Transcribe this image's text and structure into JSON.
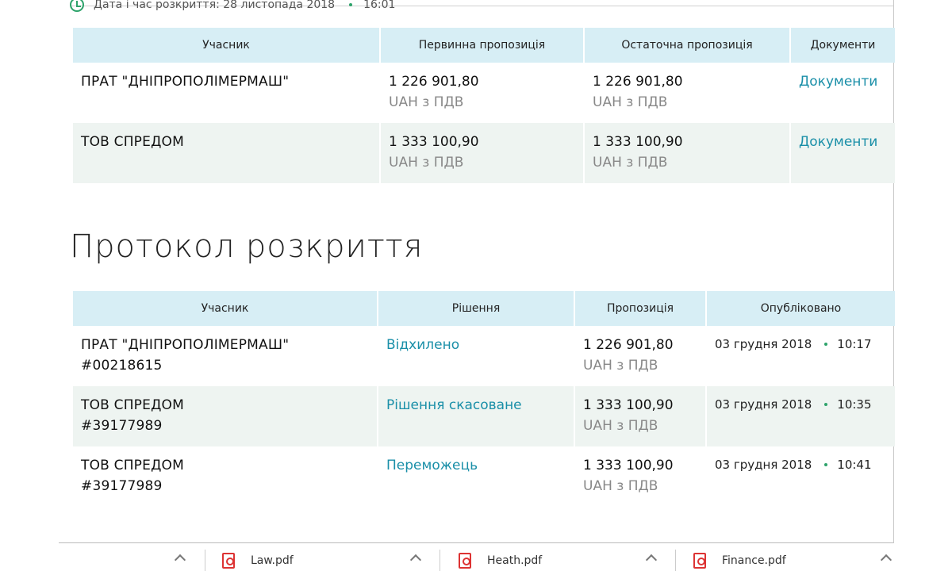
{
  "header": {
    "open_date_label": "Дата і час розкриття: 28 листопада 2018",
    "open_time": "16:01"
  },
  "offers_table": {
    "columns": [
      "Учасник",
      "Первинна пропозиція",
      "Остаточна пропозиція",
      "Документи"
    ],
    "rows": [
      {
        "participant": "ПРАТ \"ДНІПРОПОЛІМЕРМАШ\"",
        "initial_amount": "1 226 901,80",
        "initial_currency": "UAH з ПДВ",
        "final_amount": "1 226 901,80",
        "final_currency": "UAH з ПДВ",
        "documents_link": "Документи"
      },
      {
        "participant": "ТОВ СПРЕДОМ",
        "initial_amount": "1 333 100,90",
        "initial_currency": "UAH з ПДВ",
        "final_amount": "1 333 100,90",
        "final_currency": "UAH з ПДВ",
        "documents_link": "Документи"
      }
    ]
  },
  "protocol": {
    "title": "Протокол розкриття",
    "columns": [
      "Учасник",
      "Рішення",
      "Пропозиція",
      "Опубліковано"
    ],
    "rows": [
      {
        "participant": "ПРАТ \"ДНІПРОПОЛІМЕРМАШ\"",
        "code": "#00218615",
        "decision": "Відхилено",
        "amount": "1 226 901,80",
        "currency": "UAH з ПДВ",
        "date": "03 грудня 2018",
        "time": "10:17"
      },
      {
        "participant": "ТОВ СПРЕДОМ",
        "code": "#39177989",
        "decision": "Рішення скасоване",
        "amount": "1 333 100,90",
        "currency": "UAH з ПДВ",
        "date": "03 грудня 2018",
        "time": "10:35"
      },
      {
        "participant": "ТОВ СПРЕДОМ",
        "code": "#39177989",
        "decision": "Переможець",
        "amount": "1 333 100,90",
        "currency": "UAH з ПДВ",
        "date": "03 грудня 2018",
        "time": "10:41"
      }
    ]
  },
  "downloads": {
    "files": [
      "Law.pdf",
      "Heath.pdf",
      "Finance.pdf"
    ]
  },
  "colors": {
    "header_bg": "#d7eef5",
    "alt_row_bg": "#eef4f1",
    "link": "#1a8fa8",
    "accent_green": "#2ea36b"
  }
}
